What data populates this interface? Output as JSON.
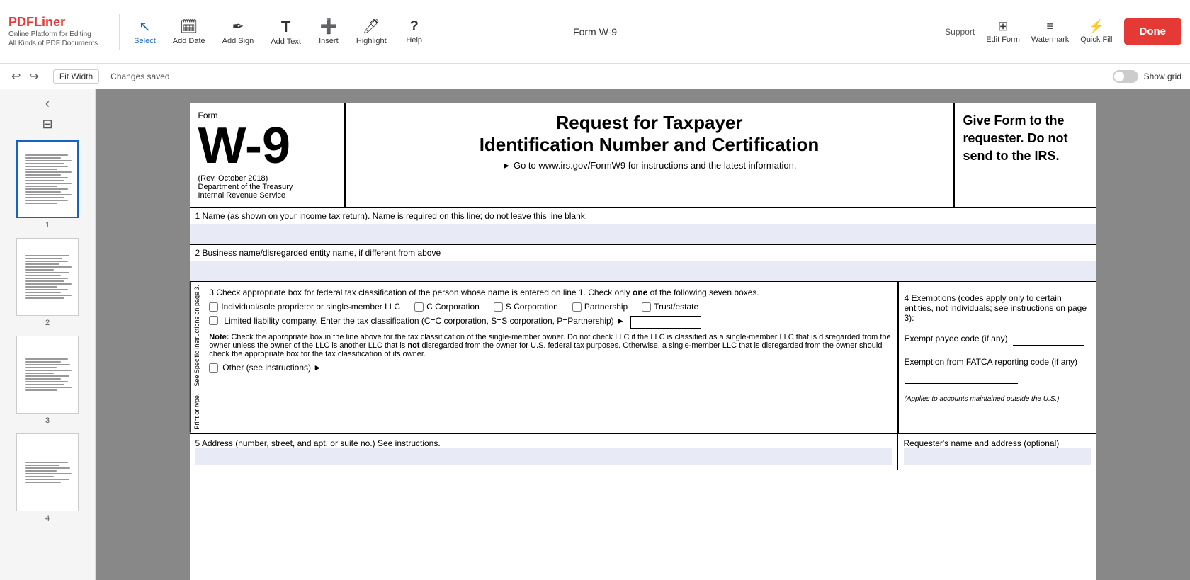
{
  "topbar": {
    "logo": "PDFLiner",
    "logo_sub": "Online Platform for Editing\nAll Kinds of PDF Documents",
    "doc_title": "Form W-9",
    "support_label": "Support",
    "tools": [
      {
        "id": "select",
        "label": "Select",
        "icon": "↖"
      },
      {
        "id": "add-date",
        "label": "Add Date",
        "icon": "📅"
      },
      {
        "id": "add-sign",
        "label": "Add Sign",
        "icon": "✒"
      },
      {
        "id": "add-text",
        "label": "Add Text",
        "icon": "T"
      },
      {
        "id": "insert",
        "label": "Insert",
        "icon": "+"
      },
      {
        "id": "highlight",
        "label": "Highlight",
        "icon": "🖊"
      },
      {
        "id": "help",
        "label": "Help",
        "icon": "?"
      }
    ],
    "right_tools": [
      {
        "id": "edit-form",
        "label": "Edit Form",
        "icon": "⊞"
      },
      {
        "id": "watermark",
        "label": "Watermark",
        "icon": "≡"
      },
      {
        "id": "quick-fill",
        "label": "Quick Fill",
        "icon": "⚡"
      }
    ],
    "done_label": "Done"
  },
  "secondbar": {
    "fit_width_label": "Fit Width",
    "changes_saved_label": "Changes saved",
    "show_grid_label": "Show grid"
  },
  "thumbnails": [
    {
      "num": "1"
    },
    {
      "num": "2"
    },
    {
      "num": "3"
    },
    {
      "num": "4"
    }
  ],
  "form": {
    "form_label": "Form",
    "form_name": "W-9",
    "rev": "(Rev. October 2018)",
    "dept1": "Department of the Treasury",
    "dept2": "Internal Revenue Service",
    "title1": "Request for Taxpayer",
    "title2": "Identification Number and Certification",
    "url_text": "► Go to www.irs.gov/FormW9 for instructions and the latest information.",
    "give_form": "Give Form to the requester. Do not send to the IRS.",
    "line1_label": "1  Name (as shown on your income tax return). Name is required on this line; do not leave this line blank.",
    "line2_label": "2  Business name/disregarded entity name, if different from above",
    "line3_label": "3  Check appropriate box for federal tax classification of the person whose name is entered on line 1. Check only",
    "line3_one": "one",
    "line3_label2": "of the following seven boxes.",
    "line4_label": "4  Exemptions (codes apply only to certain entities, not individuals; see instructions on page 3):",
    "cb_individual": "Individual/sole proprietor or single-member LLC",
    "cb_c_corp": "C Corporation",
    "cb_s_corp": "S Corporation",
    "cb_partnership": "Partnership",
    "cb_trust": "Trust/estate",
    "llc_text": "Limited liability company. Enter the tax classification (C=C corporation, S=S corporation, P=Partnership) ►",
    "note_label": "Note:",
    "note_text": "Check the appropriate box in the line above for the tax classification of the single-member owner.  Do not check LLC if the LLC is classified as a single-member LLC that is disregarded from the owner unless the owner of the LLC is another LLC that is",
    "note_not": "not",
    "note_text2": "disregarded from the owner for U.S. federal tax purposes. Otherwise, a single-member LLC that is disregarded from the owner should check the appropriate box for the tax classification of its owner.",
    "other_text": "Other (see instructions) ►",
    "exempt_payee_label": "Exempt payee code (if any)",
    "exemption_fatca_label": "Exemption from FATCA reporting code (if any)",
    "fatca_note": "(Applies to accounts maintained outside the U.S.)",
    "line5_label": "5  Address (number, street, and apt. or suite no.) See instructions.",
    "requester_label": "Requester's name and address (optional)",
    "vertical_text": "Print or type.    See Specific Instructions on page 3."
  }
}
